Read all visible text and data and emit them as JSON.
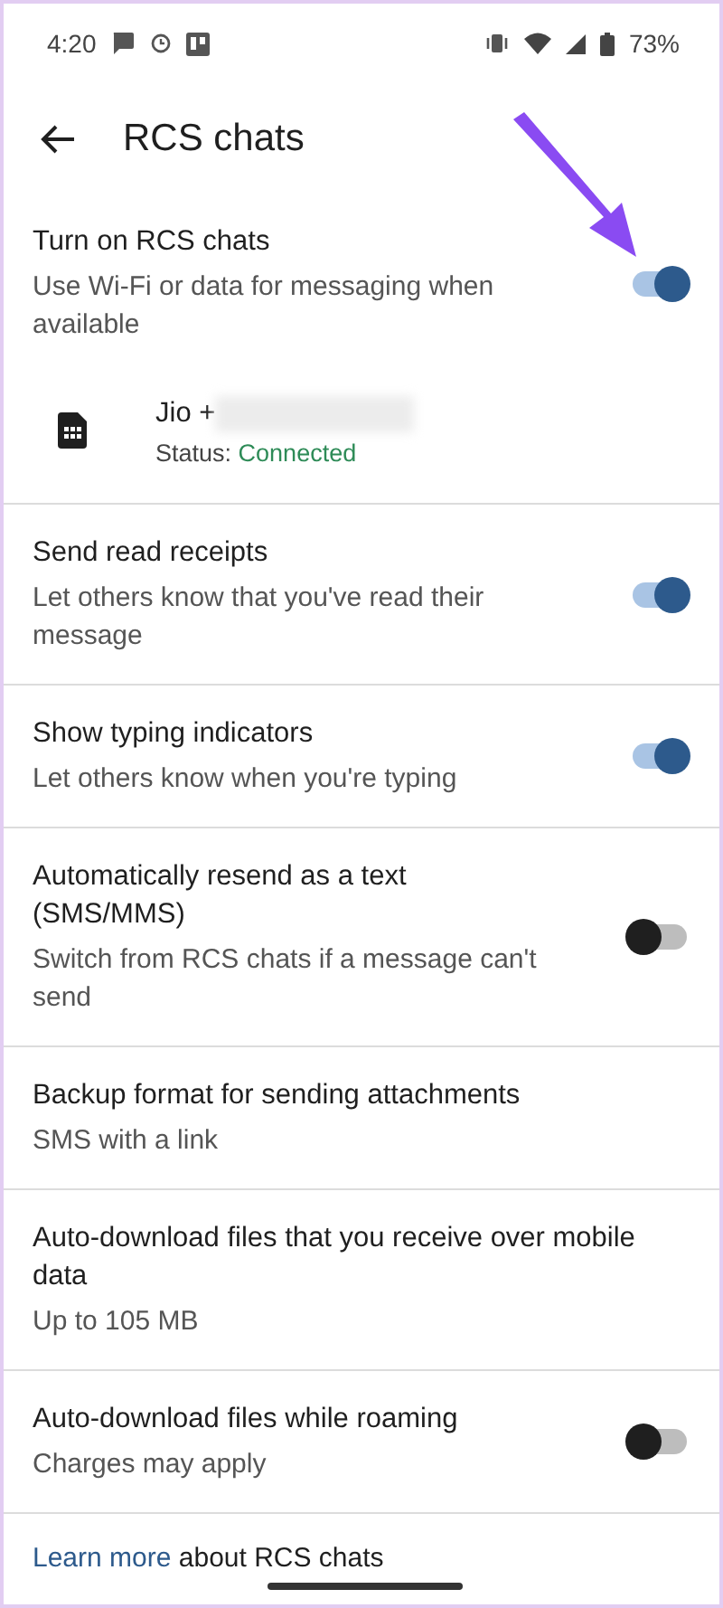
{
  "status_bar": {
    "time": "4:20",
    "battery": "73%"
  },
  "header": {
    "title": "RCS chats"
  },
  "items": [
    {
      "kind": "toggle",
      "title": "Turn on RCS chats",
      "subtitle": "Use Wi-Fi or data for messaging when available",
      "on": true
    },
    {
      "kind": "sim",
      "name": "Jio +",
      "status_label": "Status:",
      "status": "Connected"
    },
    {
      "kind": "toggle",
      "title": "Send read receipts",
      "subtitle": "Let others know that you've read their message",
      "on": true
    },
    {
      "kind": "toggle",
      "title": "Show typing indicators",
      "subtitle": "Let others know when you're typing",
      "on": true
    },
    {
      "kind": "toggle",
      "title": "Automatically resend as a text (SMS/MMS)",
      "subtitle": "Switch from RCS chats if a message can't send",
      "on": false
    },
    {
      "kind": "text",
      "title": "Backup format for sending attachments",
      "subtitle": "SMS with a link"
    },
    {
      "kind": "text",
      "title": "Auto-download files that you receive over mobile data",
      "subtitle": "Up to 105 MB"
    },
    {
      "kind": "toggle",
      "title": "Auto-download files while roaming",
      "subtitle": "Charges may apply",
      "on": false
    }
  ],
  "footer": {
    "link": "Learn more",
    "text": " about RCS chats"
  }
}
